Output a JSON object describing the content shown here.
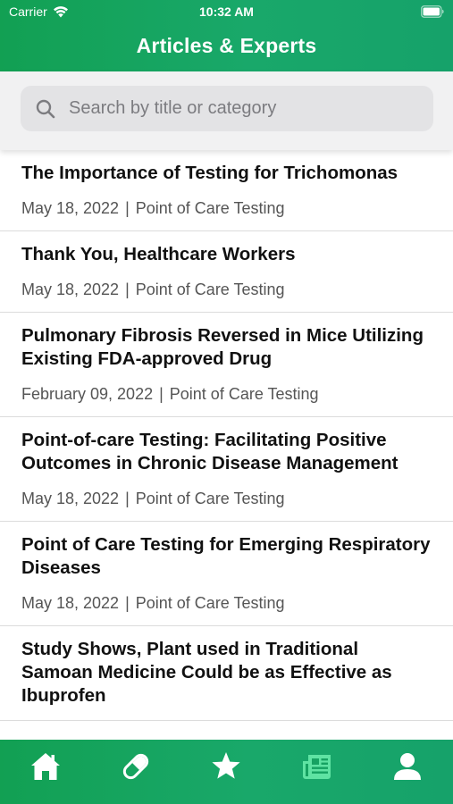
{
  "status_bar": {
    "carrier": "Carrier",
    "time": "10:32 AM"
  },
  "header": {
    "title": "Articles & Experts"
  },
  "search": {
    "placeholder": "Search by title or category",
    "value": ""
  },
  "articles": [
    {
      "title": "The Importance of Testing for Trichomonas",
      "date": "May 18, 2022",
      "separator": "|",
      "category": "Point of Care Testing"
    },
    {
      "title": "Thank You, Healthcare Workers",
      "date": "May 18, 2022",
      "separator": "|",
      "category": "Point of Care Testing"
    },
    {
      "title": "Pulmonary Fibrosis Reversed in Mice Utilizing Existing FDA-approved Drug",
      "date": "February 09, 2022",
      "separator": "|",
      "category": "Point of Care Testing"
    },
    {
      "title": "Point-of-care Testing: Facilitating Positive Outcomes in Chronic Disease Management",
      "date": "May 18, 2022",
      "separator": "|",
      "category": "Point of Care Testing"
    },
    {
      "title": "Point of Care Testing for Emerging Respiratory Diseases",
      "date": "May 18, 2022",
      "separator": "|",
      "category": "Point of Care Testing"
    },
    {
      "title": "Study Shows, Plant used in Traditional Samoan Medicine Could be as Effective as Ibuprofen",
      "date": "",
      "separator": "",
      "category": ""
    }
  ],
  "tab_bar": {
    "tabs": [
      {
        "icon": "home-icon",
        "active": false
      },
      {
        "icon": "pill-icon",
        "active": false
      },
      {
        "icon": "star-icon",
        "active": false
      },
      {
        "icon": "newspaper-icon",
        "active": true
      },
      {
        "icon": "user-icon",
        "active": false
      }
    ]
  },
  "colors": {
    "brand_green": "#14a35c",
    "active_tab": "#5fe3a3",
    "inactive_tab": "#ffffff"
  }
}
